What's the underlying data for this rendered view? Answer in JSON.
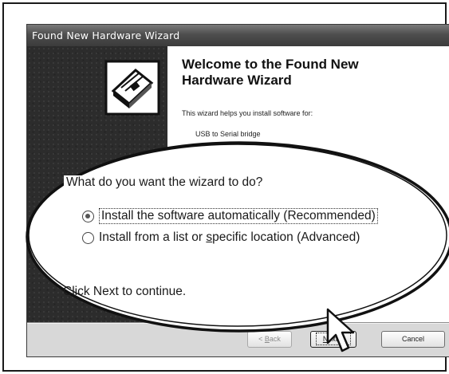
{
  "window": {
    "title": "Found New Hardware Wizard"
  },
  "wizard": {
    "heading_line1": "Welcome to the Found New",
    "heading_line2": "Hardware Wizard",
    "intro": "This wizard helps you install software for:",
    "device": "USB to Serial bridge",
    "question": "What do you want the wizard to do?",
    "options": [
      {
        "label": "Install the software automatically (Recommended)",
        "selected": true
      },
      {
        "label_before": "Install from a list or ",
        "label_underlined": "s",
        "label_after": "pecific location (Advanced)",
        "selected": false
      }
    ],
    "continue_text": "Click Next to continue."
  },
  "buttons": {
    "back_prefix": "< ",
    "back_underlined": "B",
    "back_suffix": "ack",
    "next_underlined": "N",
    "next_suffix": "ext >",
    "cancel": "Cancel"
  },
  "icons": {
    "hardware": "hardware-card-icon",
    "cursor": "mouse-pointer-icon"
  },
  "colors": {
    "titlebar": "#4e4e4e",
    "left_panel": "#2c2c2c",
    "content_bg": "#ffffff",
    "window_bg": "#d8d8d8"
  }
}
